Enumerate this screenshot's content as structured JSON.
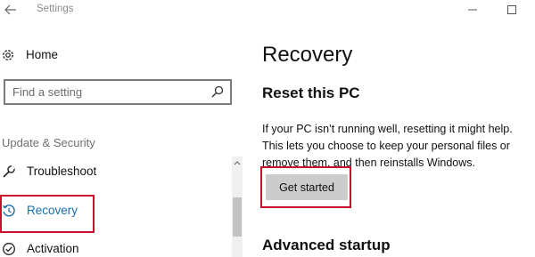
{
  "window": {
    "title": "Settings",
    "back_icon": "arrow-left-icon",
    "minimize_icon": "minimize-icon",
    "maximize_icon": "maximize-icon"
  },
  "sidebar": {
    "home_label": "Home",
    "home_icon": "gear-icon",
    "search": {
      "placeholder": "Find a setting",
      "icon": "search-icon"
    },
    "section_label": "Update & Security",
    "items": [
      {
        "label": "Troubleshoot",
        "icon": "wrench-icon",
        "selected": false
      },
      {
        "label": "Recovery",
        "icon": "history-icon",
        "selected": true
      },
      {
        "label": "Activation",
        "icon": "check-circle-icon",
        "selected": false
      }
    ]
  },
  "main": {
    "title": "Recovery",
    "section_title": "Reset this PC",
    "description": "If your PC isn’t running well, resetting it might help. This lets you choose to keep your personal files or remove them, and then reinstalls Windows.",
    "get_started_label": "Get started",
    "next_section_title": "Advanced startup"
  },
  "colors": {
    "accent": "#1a6ea8",
    "highlight_box": "#c8102e",
    "button_bg": "#cccccc"
  }
}
